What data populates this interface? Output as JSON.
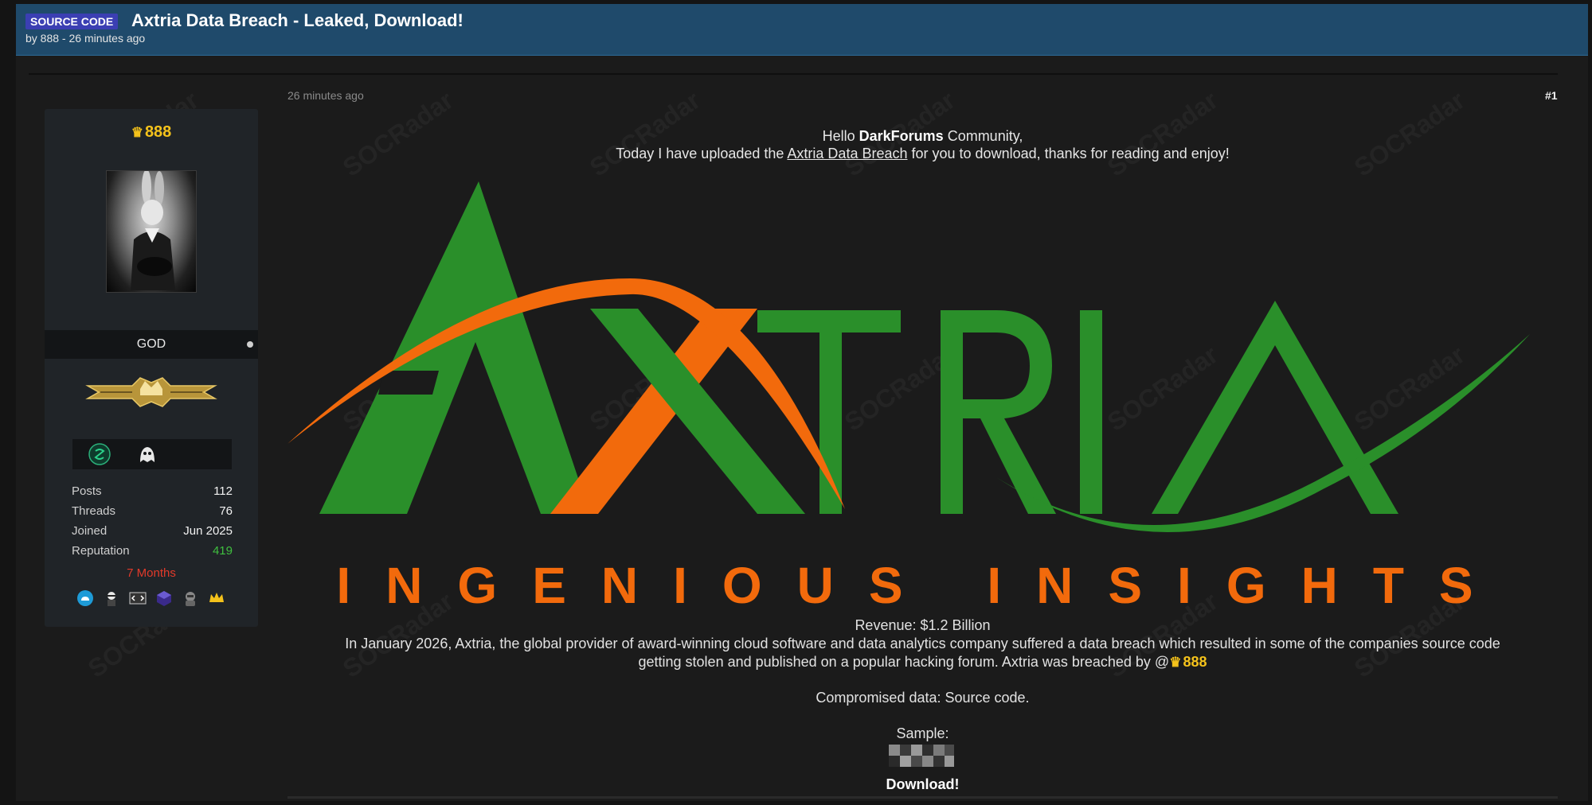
{
  "thread": {
    "tag": "SOURCE CODE",
    "title": "Axtria Data Breach - Leaked, Download!",
    "byline": "by 888 - 26 minutes ago"
  },
  "user": {
    "name": "888",
    "rank": "GOD",
    "stats": [
      {
        "label": "Posts",
        "value": "112"
      },
      {
        "label": "Threads",
        "value": "76"
      },
      {
        "label": "Joined",
        "value": "Jun 2025"
      },
      {
        "label": "Reputation",
        "value": "419"
      }
    ],
    "tenure": "7 Months",
    "badge_icons": [
      "cloud-icon",
      "ninja-icon",
      "code-icon",
      "cube-icon",
      "hacker-icon",
      "crown-icon"
    ]
  },
  "post": {
    "date": "26 minutes ago",
    "number": "#1",
    "greeting_hello": "Hello ",
    "greeting_site": "DarkForums",
    "greeting_community": " Community,",
    "intro_before": "Today I have uploaded the ",
    "intro_link": "Axtria Data Breach",
    "intro_after": " for you to download, thanks for reading and enjoy!",
    "logo_wordmark": "AXTRIA",
    "logo_tagline": "INGENIOUS INSIGHTS",
    "revenue": "Revenue: $1.2 Billion",
    "description_line1": "In January 2026, Axtria, the global provider of award-winning cloud software and data analytics company suffered a data breach which resulted in some of the companies source code",
    "description_line2": "getting stolen and published on a popular hacking forum. Axtria was breached by @",
    "mention": "888",
    "compromised": "Compromised data: Source code.",
    "sample_label": "Sample:",
    "download_label": "Download!"
  },
  "watermark_text": "SOCRadar",
  "colors": {
    "header": "#1f4a6b",
    "username": "#f4c21b",
    "reputation": "#3fbf3f",
    "tenure": "#e23a2a",
    "logo_green": "#2a8f2a",
    "logo_orange": "#f26a0c"
  }
}
